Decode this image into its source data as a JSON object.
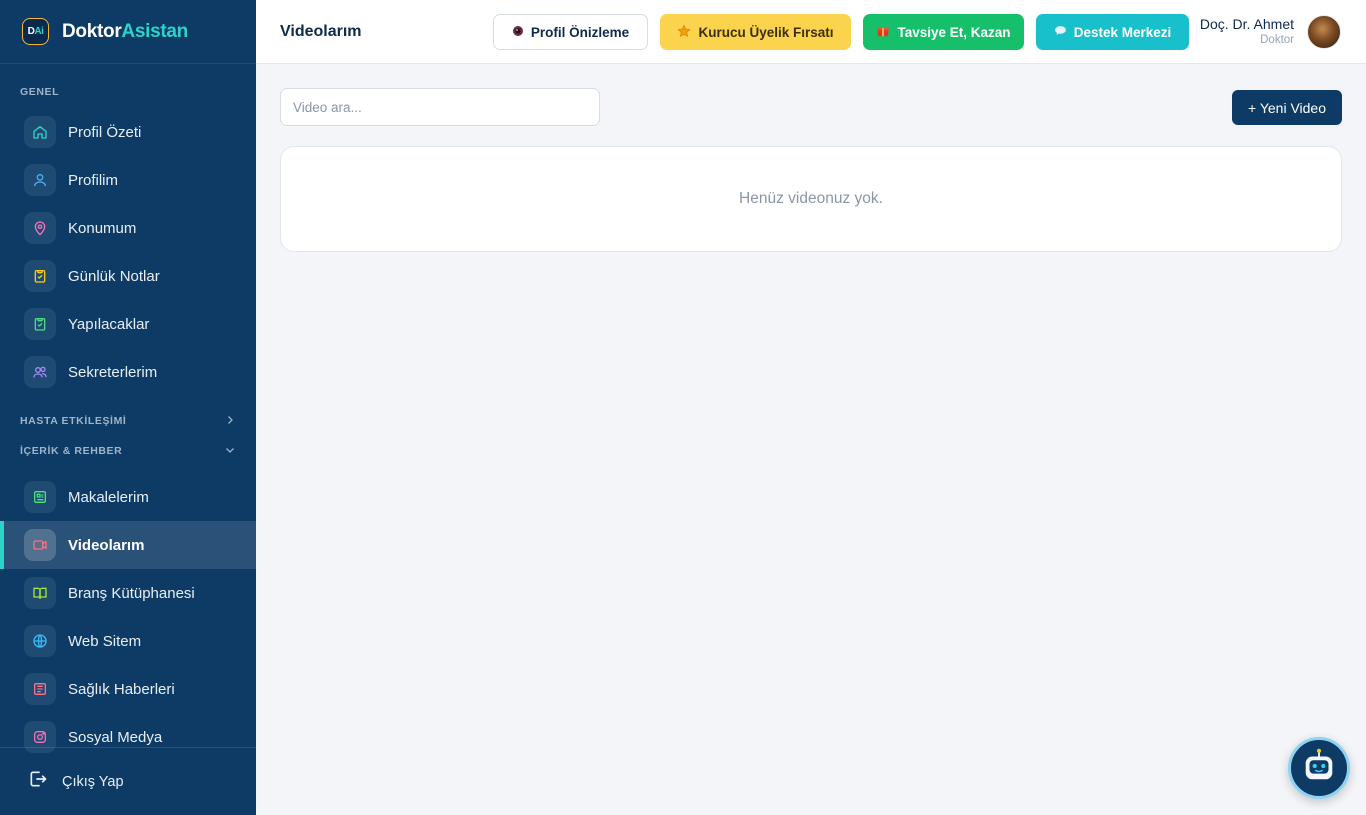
{
  "brand": {
    "logo_text_d": "D",
    "logo_text_ai": "Ai",
    "name_part1": "Doktor",
    "name_part2": "Asistan"
  },
  "sidebar": {
    "section_general": "GENEL",
    "general_items": [
      {
        "label": "Profil Özeti",
        "icon": "home-icon",
        "color": "#2bd4c7"
      },
      {
        "label": "Profilim",
        "icon": "user-icon",
        "color": "#4fb3f6"
      },
      {
        "label": "Konumum",
        "icon": "map-pin-icon",
        "color": "#f472b6"
      },
      {
        "label": "Günlük Notlar",
        "icon": "clipboard-check-icon",
        "color": "#facc15"
      },
      {
        "label": "Yapılacaklar",
        "icon": "clipboard-icon",
        "color": "#4ade80"
      },
      {
        "label": "Sekreterlerim",
        "icon": "users-icon",
        "color": "#a78bfa"
      }
    ],
    "section_patient": "HASTA ETKİLEŞİMİ",
    "section_content": "İÇERİK & REHBER",
    "content_items": [
      {
        "label": "Makalelerim",
        "icon": "newspaper-icon",
        "color": "#4ade80"
      },
      {
        "label": "Videolarım",
        "icon": "video-icon",
        "color": "#fb7185",
        "active": true
      },
      {
        "label": "Branş Kütüphanesi",
        "icon": "book-icon",
        "color": "#a3e635"
      },
      {
        "label": "Web Sitem",
        "icon": "globe-icon",
        "color": "#38bdf8"
      },
      {
        "label": "Sağlık Haberleri",
        "icon": "news-icon",
        "color": "#fb7185"
      },
      {
        "label": "Sosyal Medya",
        "icon": "instagram-icon",
        "color": "#f472b6"
      }
    ],
    "logout": "Çıkış Yap"
  },
  "header": {
    "title": "Videolarım",
    "preview_label": "Profil Önizleme",
    "founder_label": "Kurucu Üyelik Fırsatı",
    "refer_label": "Tavsiye Et, Kazan",
    "support_label": "Destek Merkezi",
    "user_name": "Doç. Dr. Ahmet",
    "user_role": "Doktor"
  },
  "main": {
    "search_placeholder": "Video ara...",
    "new_video_label": "+ Yeni Video",
    "empty_message": "Henüz videonuz yok."
  }
}
